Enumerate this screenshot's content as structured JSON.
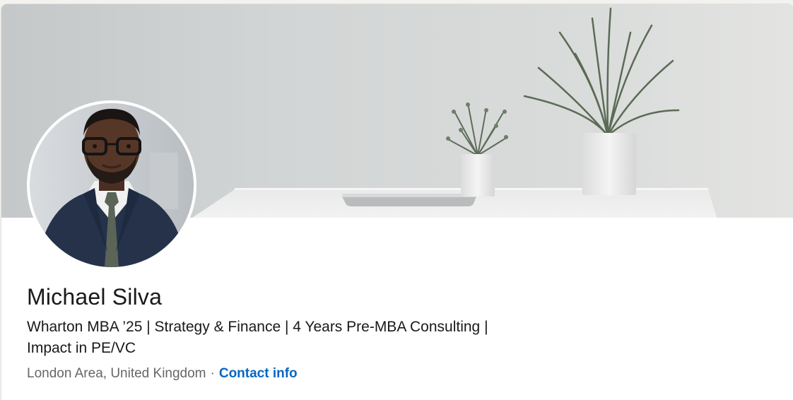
{
  "profile": {
    "name": "Michael Silva",
    "headline_line1": "Wharton MBA ’25 | Strategy & Finance | 4 Years Pre-MBA Consulting |",
    "headline_line2": "Impact in PE/VC",
    "location": "London Area, United Kingdom",
    "separator": "·",
    "contact_info_label": "Contact info"
  },
  "colors": {
    "link": "#0a66c2",
    "text_primary": "#191919",
    "text_secondary": "#666666"
  },
  "images": {
    "banner": "desk-with-plants-and-laptop-photo",
    "avatar": "profile-photo"
  }
}
